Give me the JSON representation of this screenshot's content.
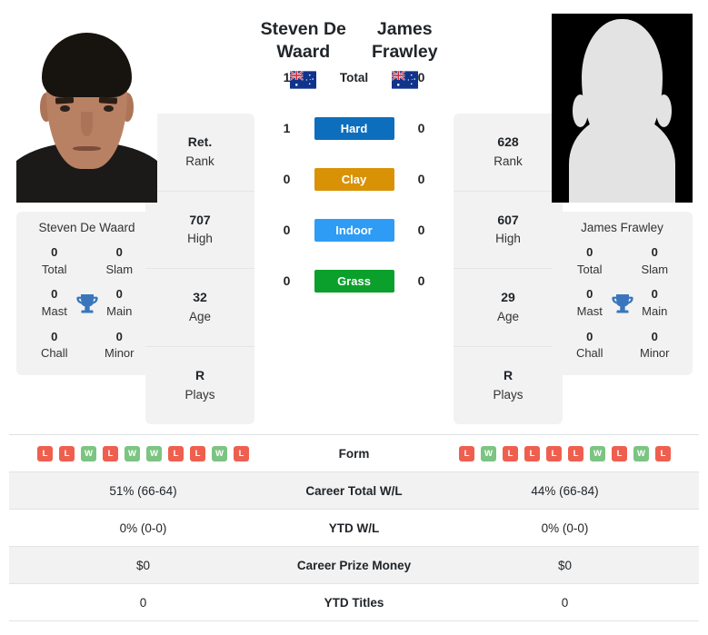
{
  "players": {
    "left": {
      "name": "Steven De Waard",
      "name_line1": "Steven De",
      "name_line2": "Waard",
      "country": "Australia",
      "flag": "au-flag-icon",
      "photo_type": "headshot-photo",
      "titles": {
        "total": "0",
        "total_label": "Total",
        "slam": "0",
        "slam_label": "Slam",
        "mast": "0",
        "mast_label": "Mast",
        "main": "0",
        "main_label": "Main",
        "chall": "0",
        "chall_label": "Chall",
        "minor": "0",
        "minor_label": "Minor"
      },
      "stats": [
        {
          "value": "Ret.",
          "label": "Rank"
        },
        {
          "value": "707",
          "label": "High"
        },
        {
          "value": "32",
          "label": "Age"
        },
        {
          "value": "R",
          "label": "Plays"
        }
      ],
      "form": [
        "L",
        "L",
        "W",
        "L",
        "W",
        "W",
        "L",
        "L",
        "W",
        "L"
      ],
      "career_total_wl": "51% (66-64)",
      "ytd_wl": "0% (0-0)",
      "career_prize_money": "$0",
      "ytd_titles": "0"
    },
    "right": {
      "name": "James Frawley",
      "name_line1": "James",
      "name_line2": "Frawley",
      "country": "Australia",
      "flag": "au-flag-icon",
      "photo_type": "silhouette-placeholder",
      "titles": {
        "total": "0",
        "total_label": "Total",
        "slam": "0",
        "slam_label": "Slam",
        "mast": "0",
        "mast_label": "Mast",
        "main": "0",
        "main_label": "Main",
        "chall": "0",
        "chall_label": "Chall",
        "minor": "0",
        "minor_label": "Minor"
      },
      "stats": [
        {
          "value": "628",
          "label": "Rank"
        },
        {
          "value": "607",
          "label": "High"
        },
        {
          "value": "29",
          "label": "Age"
        },
        {
          "value": "R",
          "label": "Plays"
        }
      ],
      "form": [
        "L",
        "W",
        "L",
        "L",
        "L",
        "L",
        "W",
        "L",
        "W",
        "L"
      ],
      "career_total_wl": "44% (66-84)",
      "ytd_wl": "0% (0-0)",
      "career_prize_money": "$0",
      "ytd_titles": "0"
    }
  },
  "head_to_head": [
    {
      "label": "Total",
      "left": "1",
      "right": "0",
      "badge": false,
      "color": ""
    },
    {
      "label": "Hard",
      "left": "1",
      "right": "0",
      "badge": true,
      "color": "#0d6ebd"
    },
    {
      "label": "Clay",
      "left": "0",
      "right": "0",
      "badge": true,
      "color": "#d99206"
    },
    {
      "label": "Indoor",
      "left": "0",
      "right": "0",
      "badge": true,
      "color": "#2e9cf5"
    },
    {
      "label": "Grass",
      "left": "0",
      "right": "0",
      "badge": true,
      "color": "#0ba02c"
    }
  ],
  "table_rows": [
    {
      "label": "Form",
      "type": "form",
      "shaded": false
    },
    {
      "label": "Career Total W/L",
      "type": "text",
      "shaded": true,
      "left": "51% (66-64)",
      "right": "44% (66-84)"
    },
    {
      "label": "YTD W/L",
      "type": "text",
      "shaded": false,
      "left": "0% (0-0)",
      "right": "0% (0-0)"
    },
    {
      "label": "Career Prize Money",
      "type": "text",
      "shaded": true,
      "left": "$0",
      "right": "$0"
    },
    {
      "label": "YTD Titles",
      "type": "text",
      "shaded": false,
      "left": "0",
      "right": "0"
    }
  ],
  "colors": {
    "hard": "#0d6ebd",
    "clay": "#d99206",
    "indoor": "#2e9cf5",
    "grass": "#0ba02c",
    "win_badge": "#7cc482",
    "loss_badge": "#ef5f4f",
    "trophy": "#3a76bd",
    "card_background": "#f2f2f2"
  }
}
